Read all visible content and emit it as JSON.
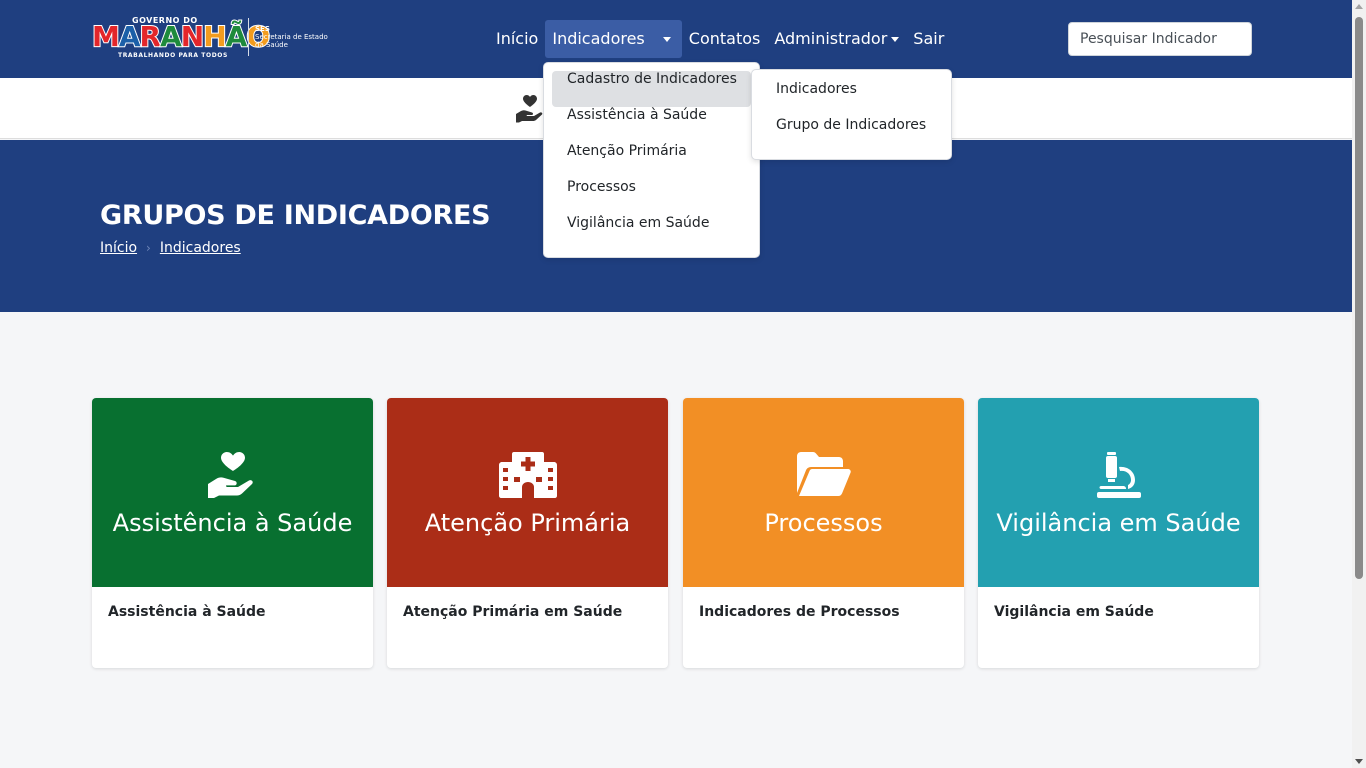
{
  "logo": {
    "top_text": "GOVERNO DO",
    "letters": [
      {
        "ch": "M",
        "color": "#e3262a"
      },
      {
        "ch": "A",
        "color": "#1b5fa8"
      },
      {
        "ch": "R",
        "color": "#e3262a"
      },
      {
        "ch": "A",
        "color": "#1e8a3c"
      },
      {
        "ch": "N",
        "color": "#e3262a"
      },
      {
        "ch": "H",
        "color": "#f39c1e"
      },
      {
        "ch": "Ã",
        "color": "#1e8a3c"
      },
      {
        "ch": "O",
        "color": "#f39c1e"
      }
    ],
    "tagline": "TRABALHANDO PARA TODOS",
    "ses_short": "SES",
    "ses_full": "Secretaria de Estado da Saúde"
  },
  "nav": {
    "items": [
      "Início",
      "Indicadores",
      "Contatos",
      "Administrador",
      "Sair"
    ]
  },
  "search": {
    "placeholder": "Pesquisar Indicador"
  },
  "dropdown": {
    "items": [
      "Cadastro de Indicadores",
      "Assistência à Saúde",
      "Atenção Primária",
      "Processos",
      "Vigilância em Saúde"
    ]
  },
  "submenu": {
    "items": [
      "Indicadores",
      "Grupo de Indicadores"
    ]
  },
  "hero": {
    "title": "GRUPOS DE INDICADORES",
    "breadcrumb": [
      "Início",
      "Indicadores"
    ]
  },
  "cards": [
    {
      "title": "Assistência à Saúde",
      "description": "Assistência à Saúde",
      "color": "#087030",
      "icon": "hand-holding-heart-icon"
    },
    {
      "title": "Atenção Primária",
      "description": "Atenção Primária em Saúde",
      "color": "#ab2d17",
      "icon": "hospital-icon"
    },
    {
      "title": "Processos",
      "description": "Indicadores de Processos",
      "color": "#f28f25",
      "icon": "folder-open-icon"
    },
    {
      "title": "Vigilância em Saúde",
      "description": "Vigilância em Saúde",
      "color": "#23a0b0",
      "icon": "microscope-icon"
    }
  ]
}
